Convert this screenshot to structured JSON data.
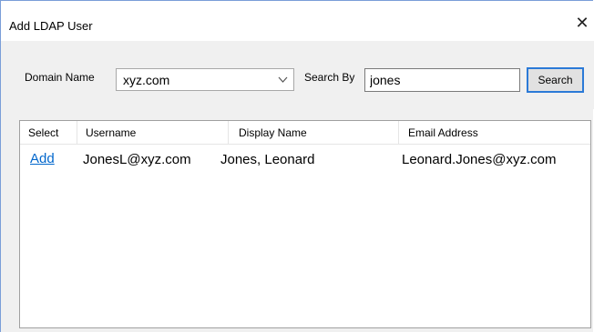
{
  "dialog": {
    "title": "Add LDAP User",
    "close_label": "✕"
  },
  "search": {
    "domain_label": "Domain Name",
    "domain_value": "xyz.com",
    "search_by_label": "Search By",
    "search_value": "jones",
    "search_button_label": "Search"
  },
  "grid": {
    "columns": [
      "Select",
      "Username",
      "Display Name",
      "Email Address"
    ],
    "rows": [
      {
        "select": "Add",
        "username": "JonesL@xyz.com",
        "display_name": "Jones, Leonard",
        "email": "Leonard.Jones@xyz.com"
      }
    ]
  },
  "icons": {
    "dropdown": "chevron-down-icon",
    "close": "close-icon"
  },
  "colors": {
    "link": "#0066cc",
    "focus_border": "#2b7ad7"
  }
}
